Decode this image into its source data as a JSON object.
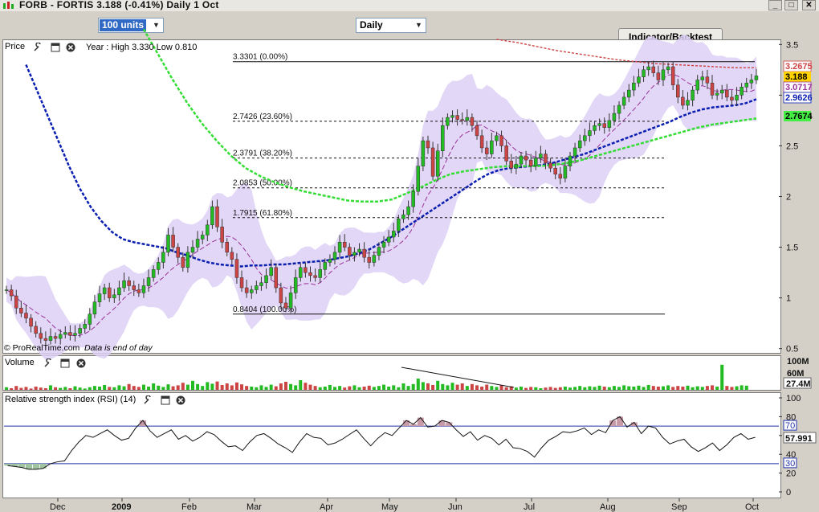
{
  "window": {
    "title": "FORB - FORTIS     3.188  (-0.41%)     Daily  1 Oct",
    "min_label": "_",
    "max_label": "□",
    "close_label": "✕"
  },
  "toolbar": {
    "units_value": "100 units",
    "period_value": "Daily",
    "indicator_button": "Indicator/Backtest"
  },
  "price_panel": {
    "title": "Price",
    "year_info": "Year : High 3.330  Low 0.810",
    "footer_brand": "© ProRealTime.com",
    "footer_note": "Data is end of day"
  },
  "volume_panel": {
    "title": "Volume"
  },
  "rsi_panel": {
    "title": "Relative strength index (RSI) (14)"
  },
  "colors": {
    "up": "#22bb22",
    "down": "#cc4444",
    "band": "#ddd0f5",
    "ma_blue": "#0a1eb0",
    "ma_green": "#33dd33",
    "ma_red": "#cc4444",
    "ma_purple": "#993399"
  },
  "chart_data": [
    {
      "type": "candlestick",
      "title": "FORB - FORTIS",
      "x_ticks": [
        "Dec",
        "2009",
        "Feb",
        "Mar",
        "Apr",
        "May",
        "Jun",
        "Jul",
        "Aug",
        "Sep",
        "Oct"
      ],
      "y_ticks": [
        0.5,
        1,
        1.5,
        2,
        2.5,
        3,
        3.5
      ],
      "ylim": [
        0.45,
        3.55
      ],
      "close": [
        1.08,
        1.02,
        0.9,
        0.85,
        0.8,
        0.72,
        0.65,
        0.6,
        0.58,
        0.62,
        0.6,
        0.64,
        0.66,
        0.63,
        0.65,
        0.7,
        0.74,
        0.84,
        0.96,
        1.04,
        1.1,
        1.0,
        1.03,
        1.1,
        1.17,
        1.12,
        1.08,
        1.05,
        1.12,
        1.2,
        1.28,
        1.35,
        1.45,
        1.62,
        1.5,
        1.4,
        1.3,
        1.45,
        1.5,
        1.58,
        1.62,
        1.72,
        1.9,
        1.7,
        1.55,
        1.45,
        1.38,
        1.2,
        1.1,
        1.05,
        1.08,
        1.12,
        1.15,
        1.22,
        1.3,
        1.1,
        0.95,
        0.9,
        1.05,
        1.2,
        1.3,
        1.25,
        1.22,
        1.2,
        1.28,
        1.35,
        1.38,
        1.45,
        1.55,
        1.5,
        1.42,
        1.45,
        1.48,
        1.4,
        1.35,
        1.42,
        1.5,
        1.55,
        1.6,
        1.66,
        1.78,
        1.82,
        1.9,
        2.05,
        2.3,
        2.55,
        2.48,
        2.2,
        2.45,
        2.7,
        2.78,
        2.8,
        2.76,
        2.75,
        2.78,
        2.7,
        2.6,
        2.48,
        2.42,
        2.55,
        2.6,
        2.5,
        2.35,
        2.28,
        2.32,
        2.4,
        2.36,
        2.3,
        2.38,
        2.42,
        2.33,
        2.28,
        2.22,
        2.18,
        2.3,
        2.4,
        2.48,
        2.55,
        2.6,
        2.65,
        2.7,
        2.72,
        2.68,
        2.75,
        2.82,
        2.9,
        2.98,
        3.05,
        3.12,
        3.18,
        3.25,
        3.28,
        3.22,
        3.15,
        3.25,
        3.28,
        3.1,
        2.98,
        2.9,
        2.95,
        3.05,
        3.15,
        3.18,
        3.12,
        3.0,
        3.02,
        3.05,
        2.98,
        2.95,
        3.0,
        3.08,
        3.12,
        3.15,
        3.19
      ],
      "ma_blue": [
        3.3,
        3.05,
        2.8,
        2.55,
        2.3,
        2.08,
        1.9,
        1.76,
        1.65,
        1.58,
        1.55,
        1.53,
        1.51,
        1.49,
        1.45,
        1.42,
        1.38,
        1.35,
        1.33,
        1.32,
        1.31,
        1.32,
        1.32,
        1.33,
        1.33,
        1.34,
        1.35,
        1.36,
        1.37,
        1.39,
        1.41,
        1.44,
        1.48,
        1.54,
        1.6,
        1.67,
        1.74,
        1.81,
        1.88,
        1.95,
        2.02,
        2.09,
        2.16,
        2.22,
        2.26,
        2.28,
        2.29,
        2.3,
        2.31,
        2.33,
        2.36,
        2.39,
        2.42,
        2.46,
        2.5,
        2.54,
        2.58,
        2.62,
        2.66,
        2.7,
        2.74,
        2.79,
        2.83,
        2.86,
        2.88,
        2.89,
        2.9,
        2.92,
        2.96
      ],
      "ma_green": [
        3.65,
        3.4,
        3.15,
        2.92,
        2.72,
        2.55,
        2.4,
        2.28,
        2.2,
        2.14,
        2.09,
        2.05,
        2.02,
        1.99,
        1.96,
        1.95,
        1.95,
        1.97,
        2.03,
        2.09,
        2.16,
        2.22,
        2.25,
        2.27,
        2.29,
        2.3,
        2.3,
        2.3,
        2.31,
        2.33,
        2.36,
        2.4,
        2.44,
        2.48,
        2.52,
        2.56,
        2.6,
        2.64,
        2.68,
        2.71,
        2.73,
        2.75,
        2.77
      ],
      "ma_red": [
        3.55,
        3.52,
        3.48,
        3.44,
        3.41,
        3.38,
        3.35,
        3.33,
        3.31,
        3.3,
        3.29,
        3.28,
        3.27,
        3.27
      ],
      "fib_levels": [
        {
          "value": 3.3301,
          "label": "3.3301 (0.00%)"
        },
        {
          "value": 2.7426,
          "label": "2.7426 (23.60%)"
        },
        {
          "value": 2.3791,
          "label": "2.3791 (38.20%)"
        },
        {
          "value": 2.0853,
          "label": "2.0853 (50.00%)"
        },
        {
          "value": 1.7915,
          "label": "1.7915 (61.80%)"
        },
        {
          "value": 0.8404,
          "label": "0.8404 (100.00%)"
        }
      ],
      "last_values": [
        {
          "label": "3.2675",
          "color": "#cc4444"
        },
        {
          "label": "3.188",
          "color": "#000000",
          "bg": "#ffd200"
        },
        {
          "label": "3.0717",
          "color": "#993399"
        },
        {
          "label": "2.9626",
          "color": "#0a1eb0"
        },
        {
          "label": "2.7674",
          "color": "#000000",
          "bg": "#44ee44"
        }
      ]
    },
    {
      "type": "bar",
      "title": "Volume",
      "y_ticks": [
        "100M",
        "60M"
      ],
      "last_value": "27.4M",
      "ylim": [
        0,
        100
      ],
      "values_m": [
        8,
        5,
        12,
        6,
        9,
        4,
        10,
        7,
        5,
        14,
        8,
        6,
        9,
        5,
        11,
        7,
        4,
        8,
        12,
        10,
        15,
        9,
        8,
        14,
        11,
        18,
        12,
        9,
        16,
        10,
        20,
        13,
        9,
        17,
        11,
        14,
        22,
        16,
        28,
        18,
        12,
        24,
        19,
        26,
        15,
        20,
        14,
        23,
        17,
        12,
        10,
        8,
        14,
        9,
        16,
        11,
        20,
        25,
        18,
        14,
        30,
        22,
        16,
        12,
        8,
        10,
        15,
        9,
        12,
        7,
        11,
        14,
        8,
        10,
        13,
        9,
        12,
        16,
        10,
        14,
        8,
        20,
        12,
        18,
        35,
        24,
        20,
        15,
        28,
        18,
        14,
        22,
        16,
        20,
        12,
        18,
        14,
        10,
        16,
        12,
        9,
        14,
        8,
        11,
        7,
        10,
        6,
        9,
        8,
        5,
        7,
        9,
        6,
        8,
        10,
        7,
        9,
        12,
        8,
        11,
        9,
        13,
        10,
        8,
        12,
        9,
        14,
        11,
        10,
        13,
        9,
        15,
        12,
        10,
        11,
        14,
        9,
        12,
        10,
        13,
        8,
        11,
        9,
        12,
        14,
        10,
        78,
        12,
        9,
        11,
        14,
        13
      ]
    },
    {
      "type": "line",
      "title": "Relative strength index (RSI) (14)",
      "y_ticks": [
        0,
        20,
        40,
        60,
        80,
        100
      ],
      "ylim": [
        0,
        100
      ],
      "bands": [
        30,
        70
      ],
      "last_value": "57.991",
      "values": [
        28,
        27,
        26,
        24,
        24,
        25,
        30,
        32,
        33,
        44,
        53,
        60,
        58,
        62,
        66,
        60,
        55,
        57,
        68,
        76,
        65,
        58,
        62,
        66,
        56,
        60,
        54,
        58,
        64,
        61,
        54,
        48,
        49,
        44,
        53,
        60,
        62,
        57,
        51,
        47,
        42,
        53,
        62,
        58,
        57,
        50,
        52,
        56,
        61,
        66,
        57,
        49,
        57,
        63,
        60,
        68,
        76,
        72,
        79,
        69,
        70,
        76,
        74,
        66,
        59,
        64,
        55,
        60,
        57,
        50,
        56,
        47,
        46,
        43,
        37,
        47,
        55,
        59,
        64,
        63,
        65,
        68,
        61,
        66,
        63,
        76,
        80,
        69,
        74,
        62,
        70,
        68,
        58,
        51,
        54,
        56,
        48,
        43,
        47,
        52,
        44,
        50,
        58,
        62,
        56,
        58
      ]
    }
  ]
}
